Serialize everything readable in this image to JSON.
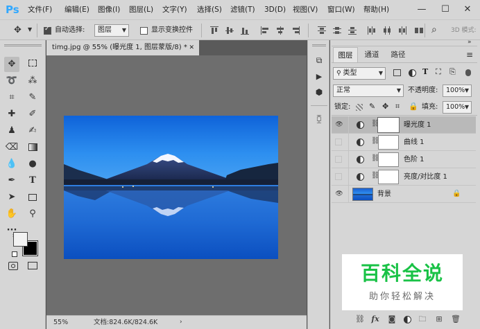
{
  "app": {
    "logo": "Ps",
    "menu": [
      "文件(F)",
      "编辑(E)",
      "图像(I)",
      "图层(L)",
      "文字(Y)",
      "选择(S)",
      "滤镜(T)",
      "3D(D)",
      "视图(V)",
      "窗口(W)",
      "帮助(H)"
    ],
    "window_controls": [
      "—",
      "☐",
      "✕"
    ]
  },
  "options_bar": {
    "auto_select_label": "自动选择:",
    "auto_select_checked": true,
    "auto_select_target": "图层",
    "show_transform_label": "显示变换控件",
    "show_transform_checked": false,
    "mode_3d_label": "3D 模式:"
  },
  "document": {
    "tab_title": "timg.jpg @ 55% (曝光度 1, 图层蒙版/8) *",
    "zoom": "55%",
    "doc_info": "文档:824.6K/824.6K"
  },
  "layers_panel": {
    "tabs": [
      "图层",
      "通道",
      "路径"
    ],
    "filter_kind": "类型",
    "blend_mode": "正常",
    "opacity_label": "不透明度:",
    "opacity_value": "100%",
    "lock_label": "锁定:",
    "fill_label": "填充:",
    "fill_value": "100%",
    "layers": [
      {
        "name": "曝光度 1",
        "visible": true,
        "selected": true,
        "type": "adjustment"
      },
      {
        "name": "曲线 1",
        "visible": false,
        "selected": false,
        "type": "adjustment"
      },
      {
        "name": "色阶 1",
        "visible": false,
        "selected": false,
        "type": "adjustment"
      },
      {
        "name": "亮度/对比度 1",
        "visible": false,
        "selected": false,
        "type": "adjustment"
      },
      {
        "name": "背景",
        "visible": true,
        "selected": false,
        "type": "background",
        "locked": true
      }
    ]
  },
  "watermark": {
    "title": "百科全说",
    "subtitle": "助你轻松解决"
  },
  "colors": {
    "chrome": "#d6d6d6",
    "workspace": "#6e6e6e",
    "ps_blue": "#31a8ff",
    "watermark_green": "#19c246"
  }
}
